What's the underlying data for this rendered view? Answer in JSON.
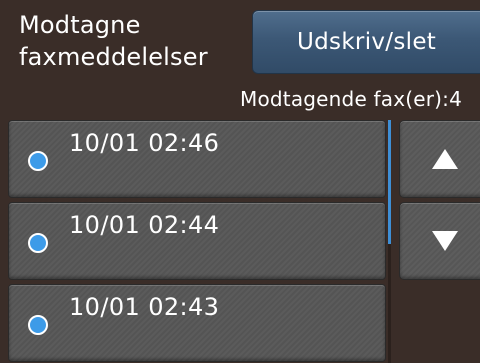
{
  "header": {
    "title": "Modtagne\nfaxmeddelelser",
    "print_button_label": "Udskriv/slet"
  },
  "status": {
    "received_count_label": "Modtagende fax(er):4"
  },
  "fax_list": [
    {
      "time": "10/01 02:46"
    },
    {
      "time": "10/01 02:44"
    },
    {
      "time": "10/01 02:43"
    }
  ],
  "icons": {
    "scroll_up": "up-triangle-icon",
    "scroll_down": "down-triangle-icon",
    "unread_marker": "blue-dot-icon"
  },
  "colors": {
    "background": "#3a2d28",
    "accent_blue": "#3d9be8",
    "button_blue": "#3c5876"
  }
}
